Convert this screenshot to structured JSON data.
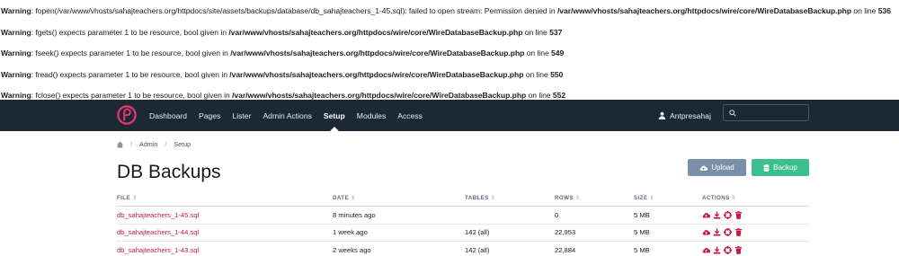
{
  "warnings": [
    {
      "label": "Warning",
      "message": ": fopen(/var/www/vhosts/sahajteachers.org/httpdocs/site/assets/backups/database/db_sahajteachers_1-45.sql): failed to open stream: Permission denied in ",
      "path": "/var/www/vhosts/sahajteachers.org/httpdocs/wire/core/WireDatabaseBackup.php",
      "on_line": " on line ",
      "line": "536"
    },
    {
      "label": "Warning",
      "message": ": fgets() expects parameter 1 to be resource, bool given in ",
      "path": "/var/www/vhosts/sahajteachers.org/httpdocs/wire/core/WireDatabaseBackup.php",
      "on_line": " on line ",
      "line": "537"
    },
    {
      "label": "Warning",
      "message": ": fseek() expects parameter 1 to be resource, bool given in ",
      "path": "/var/www/vhosts/sahajteachers.org/httpdocs/wire/core/WireDatabaseBackup.php",
      "on_line": " on line ",
      "line": "549"
    },
    {
      "label": "Warning",
      "message": ": fread() expects parameter 1 to be resource, bool given in ",
      "path": "/var/www/vhosts/sahajteachers.org/httpdocs/wire/core/WireDatabaseBackup.php",
      "on_line": " on line ",
      "line": "550"
    },
    {
      "label": "Warning",
      "message": ": fclose() expects parameter 1 to be resource, bool given in ",
      "path": "/var/www/vhosts/sahajteachers.org/httpdocs/wire/core/WireDatabaseBackup.php",
      "on_line": " on line ",
      "line": "552"
    }
  ],
  "nav": {
    "items": [
      "Dashboard",
      "Pages",
      "Lister",
      "Admin Actions",
      "Setup",
      "Modules",
      "Access"
    ],
    "active": "Setup",
    "user": "Antpresahaj",
    "search_placeholder": ""
  },
  "breadcrumb": {
    "items": [
      "Admin",
      "Setup"
    ]
  },
  "page": {
    "title": "DB Backups"
  },
  "buttons": {
    "upload": "Upload",
    "backup": "Backup"
  },
  "table": {
    "headers": [
      "FILE",
      "DATE",
      "TABLES",
      "ROWS",
      "SIZE",
      "ACTIONS"
    ],
    "sort_glyph": "⇕",
    "rows": [
      {
        "file": "db_sahajteachers_1-45.sql",
        "date": "8 minutes ago",
        "tables": "",
        "rows": "0",
        "size": "5 MB"
      },
      {
        "file": "db_sahajteachers_1-44.sql",
        "date": "1 week ago",
        "tables": "142 (all)",
        "rows": "22,953",
        "size": "5 MB"
      },
      {
        "file": "db_sahajteachers_1-43.sql",
        "date": "2 weeks ago",
        "tables": "142 (all)",
        "rows": "22,884",
        "size": "5 MB"
      }
    ]
  },
  "colors": {
    "navbar": "#1c2836",
    "brand": "#e8356d",
    "link": "#c8183d",
    "upload": "#7a8fa8",
    "backup": "#3bbf8f"
  },
  "icons": {
    "logo": "processwire-logo-icon",
    "user": "user-icon",
    "search": "search-icon",
    "home": "home-icon",
    "upload": "cloud-upload-icon",
    "backup": "database-icon",
    "actions": [
      "cloud-upload-icon",
      "download-icon",
      "restore-icon",
      "trash-icon"
    ]
  }
}
